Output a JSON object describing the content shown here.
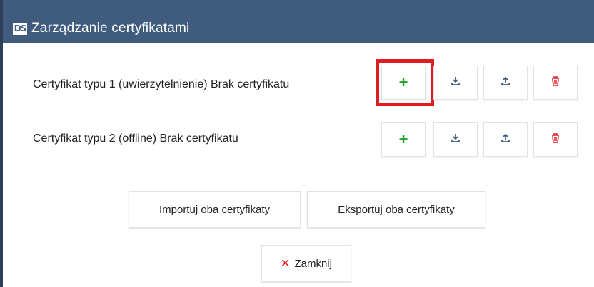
{
  "dialog": {
    "logo_text": "DS",
    "title": "Zarządzanie certyfikatami"
  },
  "rows": [
    {
      "label": "Certyfikat typu 1 (uwierzytelnienie) Brak certyfikatu"
    },
    {
      "label": "Certyfikat typu 2 (offline) Brak certyfikatu"
    }
  ],
  "row_actions": {
    "add_icon": "plus",
    "download_icon": "download-icon",
    "upload_icon": "upload-icon",
    "delete_icon": "trash-icon",
    "add_glyph": "+"
  },
  "footer": {
    "import_both": "Importuj oba certyfikaty",
    "export_both": "Eksportuj oba certyfikaty",
    "close_glyph": "✕",
    "close_label": "Zamknij"
  },
  "colors": {
    "titlebar": "#3f5b7d",
    "add": "#1f9e2b",
    "delete": "#e11b22",
    "highlight": "#e11b22",
    "icon": "#3f5b7d"
  }
}
